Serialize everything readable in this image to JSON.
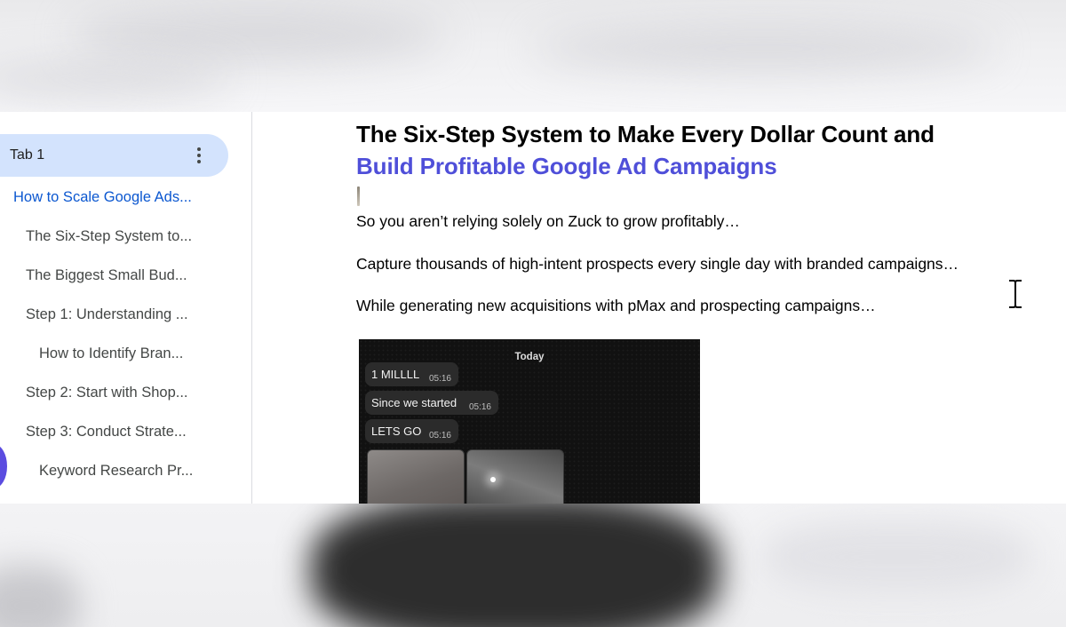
{
  "sidebar": {
    "tab": {
      "label": "Tab 1"
    },
    "items": [
      {
        "label": "How to Scale Google Ads..."
      },
      {
        "label": "The Six-Step System to..."
      },
      {
        "label": "The Biggest Small Bud..."
      },
      {
        "label": "Step 1: Understanding ..."
      },
      {
        "label": "How to Identify Bran..."
      },
      {
        "label": "Step 2: Start with Shop..."
      },
      {
        "label": "Step 3: Conduct Strate..."
      },
      {
        "label": "Keyword Research Pr..."
      }
    ]
  },
  "document": {
    "heading_line1": "The Six-Step System to Make Every Dollar Count and",
    "heading_line2": "Build Profitable Google Ad Campaigns",
    "paragraphs": [
      "So you aren’t relying solely on Zuck to grow profitably…",
      "Capture thousands of high-intent prospects every single day with branded campaigns…",
      "While generating new acquisitions with pMax and prospecting campaigns…"
    ],
    "chat_image": {
      "day_label": "Today",
      "messages": [
        {
          "text": "1 MILLLL",
          "time": "05:16"
        },
        {
          "text": "Since we started",
          "time": "05:16"
        },
        {
          "text": "LETS GO",
          "time": "05:16"
        }
      ]
    }
  },
  "colors": {
    "accent_blue": "#0b57d0",
    "tab_highlight": "#d3e3fd",
    "heading_blue": "#4f4fd9"
  }
}
